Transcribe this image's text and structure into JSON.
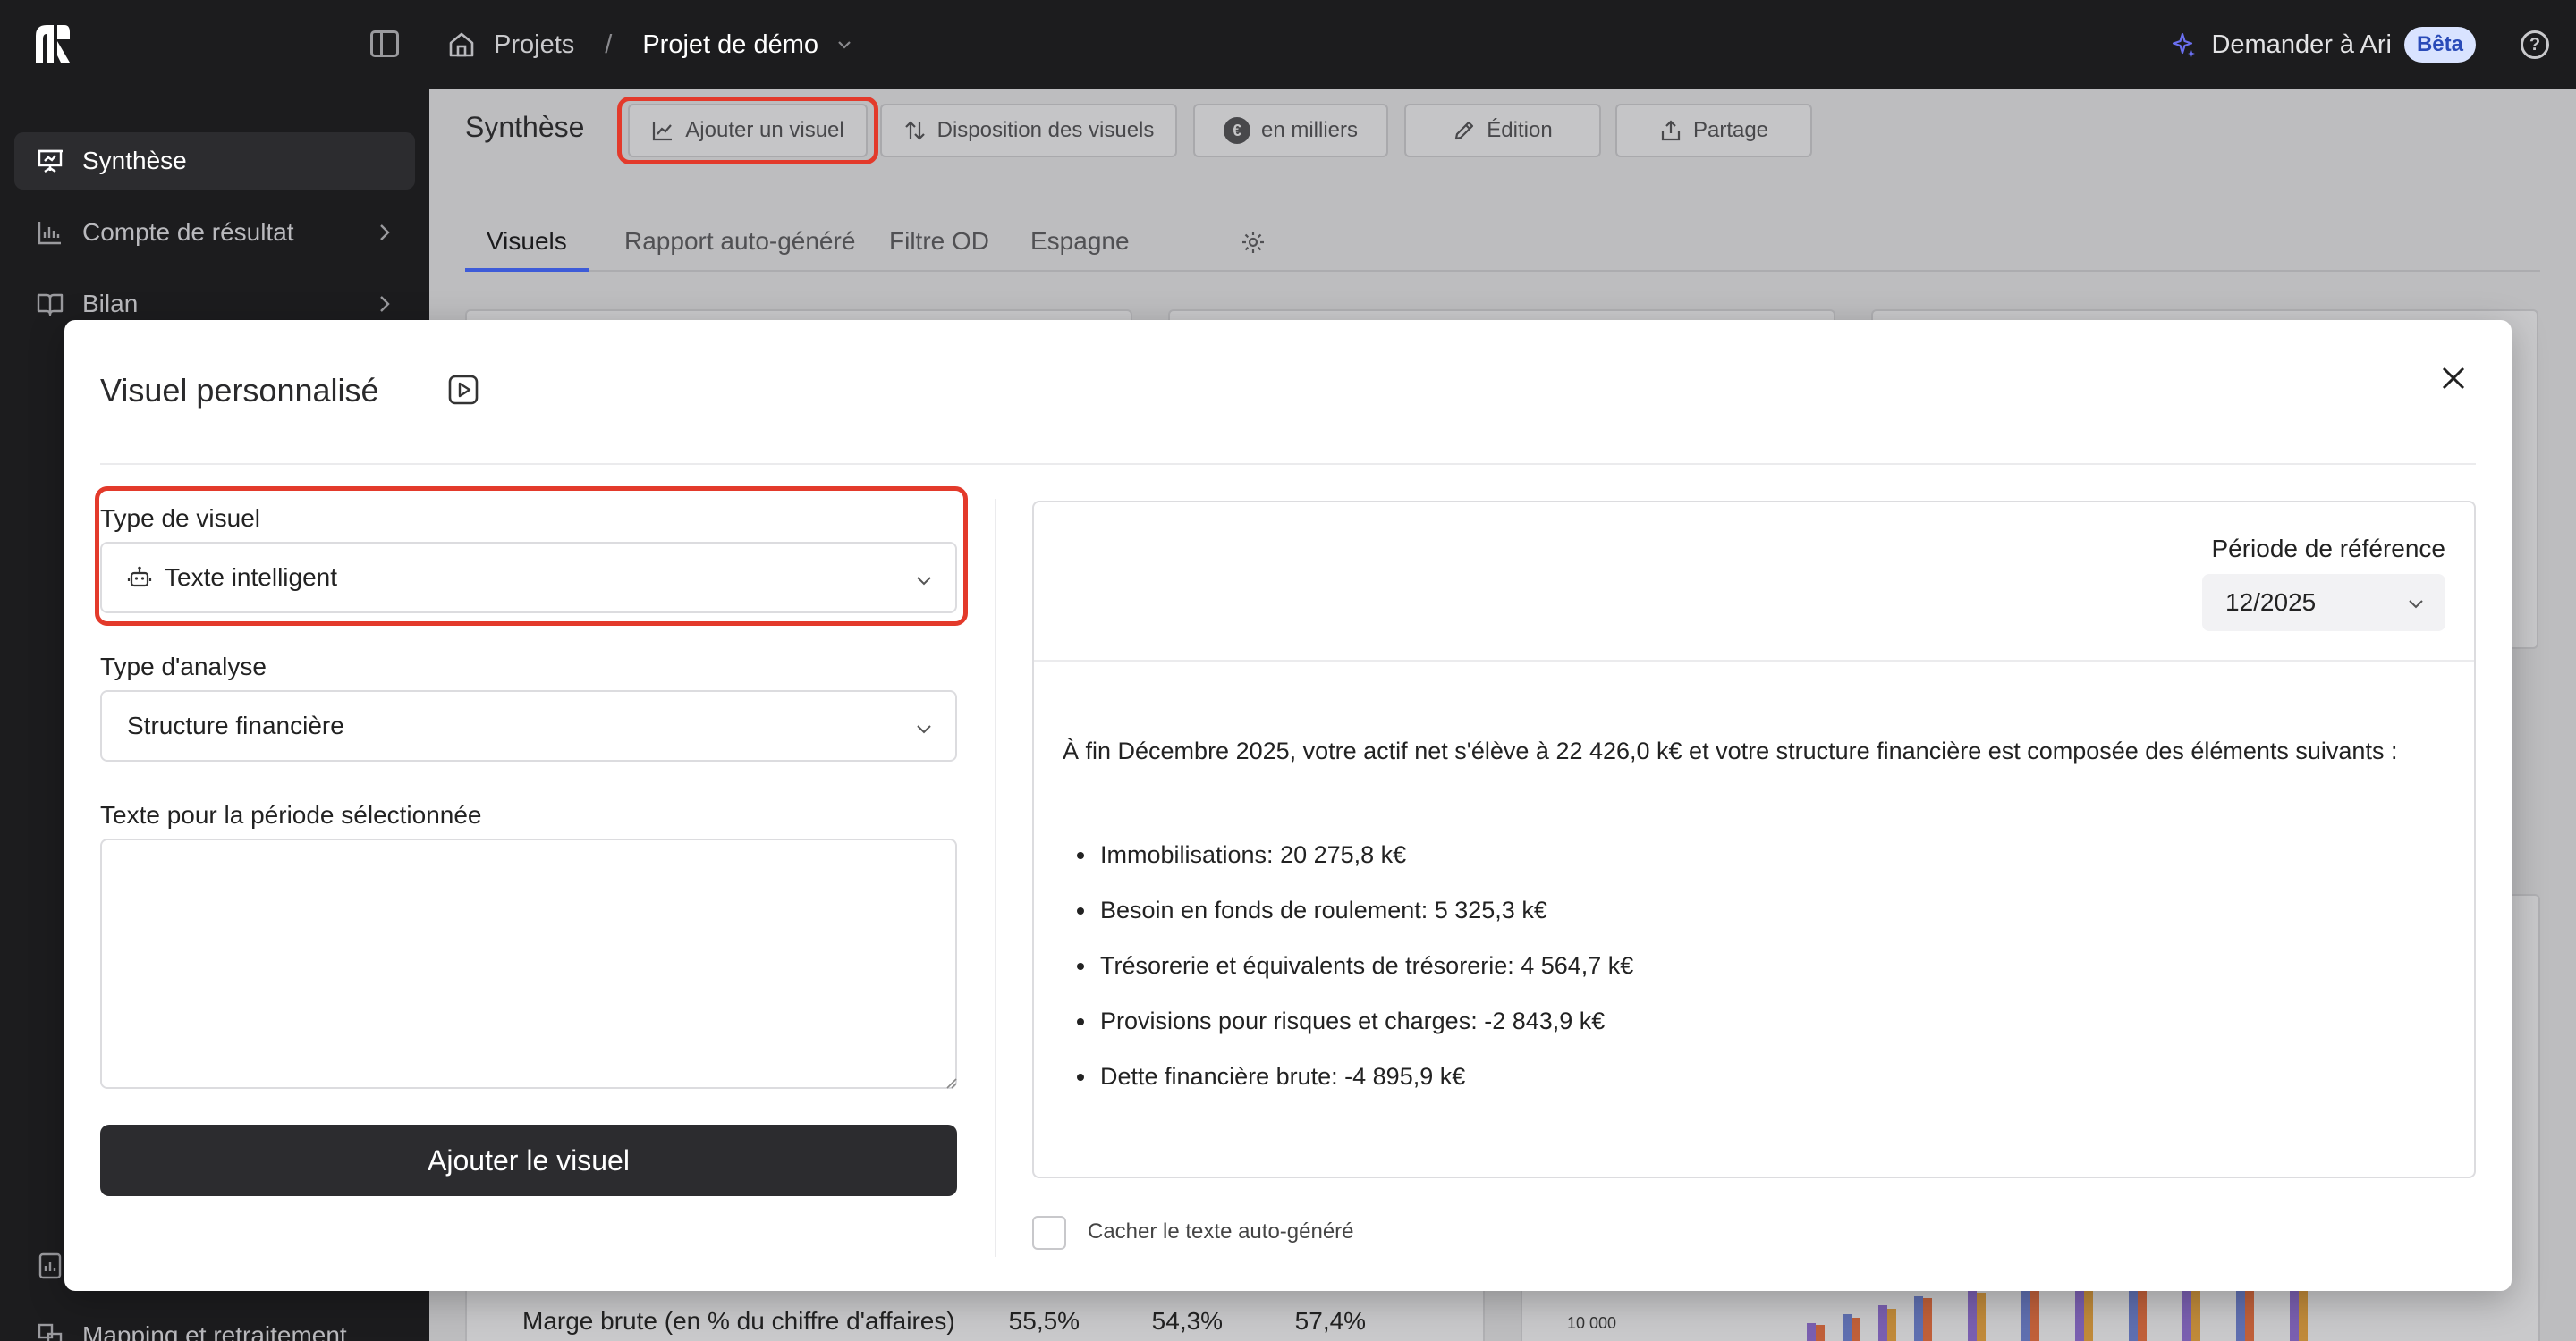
{
  "topbar": {
    "breadcrumb_projects": "Projets",
    "breadcrumb_sep": "/",
    "breadcrumb_current": "Projet de démo",
    "ask_ari": "Demander à Ari",
    "beta": "Bêta"
  },
  "sidebar": {
    "items": [
      {
        "label": "Synthèse",
        "icon": "presentation-icon",
        "active": true
      },
      {
        "label": "Compte de résultat",
        "icon": "bar-chart-icon"
      },
      {
        "label": "Bilan",
        "icon": "book-icon"
      }
    ],
    "bottom_item": "Mapping et retraitement"
  },
  "main": {
    "title": "Synthèse",
    "toolbar": {
      "add_visual": "Ajouter un visuel",
      "layout": "Disposition des visuels",
      "currency_symbol": "€",
      "units": "en milliers",
      "edit": "Édition",
      "share": "Partage"
    },
    "tabs": [
      "Visuels",
      "Rapport auto-généré",
      "Filtre OD",
      "Espagne"
    ],
    "background_row": {
      "label": "Marge brute (en % du chiffre d'affaires)",
      "values": [
        "55,5%",
        "54,3%",
        "57,4%"
      ]
    },
    "background_axis_label": "10 000"
  },
  "modal": {
    "title": "Visuel personnalisé",
    "visual_type_label": "Type de visuel",
    "visual_type_value": "Texte intelligent",
    "analysis_type_label": "Type d'analyse",
    "analysis_type_value": "Structure financière",
    "text_label": "Texte pour la période sélectionnée",
    "text_value": "",
    "submit": "Ajouter le visuel",
    "preview": {
      "period_label": "Période de référence",
      "period_value": "12/2025",
      "intro": "À fin Décembre 2025, votre actif net s'élève à 22 426,0 k€ et votre structure financière est composée des éléments suivants :",
      "bullets": [
        "Immobilisations: 20 275,8 k€",
        "Besoin en fonds de roulement: 5 325,3 k€",
        "Trésorerie et équivalents de trésorerie: 4 564,7 k€",
        "Provisions pour risques et charges: -2 843,9 k€",
        "Dette financière brute: -4 895,9 k€"
      ]
    },
    "hide_autotext_label": "Cacher le texte auto-généré"
  },
  "colors": {
    "highlight": "#e33a2b",
    "accent": "#3d5bd8",
    "primary_button": "#2c2c2f",
    "beta_bg": "#d9e3ff"
  }
}
